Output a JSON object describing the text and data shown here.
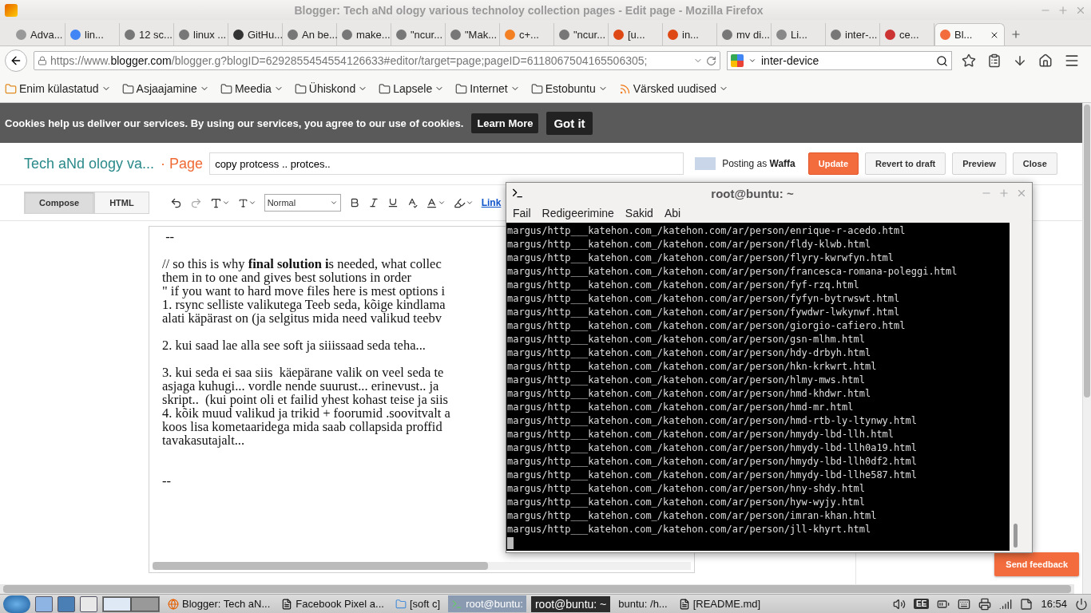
{
  "window": {
    "title": "Blogger: Tech aNd ology various technoloy collection pages - Edit page - Mozilla Firefox"
  },
  "tabs": [
    {
      "label": "Adva...",
      "selected": false
    },
    {
      "label": "lin...",
      "selected": false
    },
    {
      "label": "12 sc...",
      "selected": false
    },
    {
      "label": "linux ...",
      "selected": false
    },
    {
      "label": "GitHu...",
      "selected": false
    },
    {
      "label": "An be...",
      "selected": false
    },
    {
      "label": "make...",
      "selected": false
    },
    {
      "label": "\"ncur...",
      "selected": false
    },
    {
      "label": "\"Mak...",
      "selected": false
    },
    {
      "label": "c+...",
      "selected": false
    },
    {
      "label": "\"ncur...",
      "selected": false
    },
    {
      "label": "[u...",
      "selected": false
    },
    {
      "label": "in...",
      "selected": false
    },
    {
      "label": "mv di...",
      "selected": false
    },
    {
      "label": "Li...",
      "selected": false
    },
    {
      "label": "inter-...",
      "selected": false
    },
    {
      "label": "ce...",
      "selected": false
    },
    {
      "label": "Bl...",
      "selected": true
    }
  ],
  "address_bar": {
    "url": "https://www.**blogger.com**/blogger.g?blogID=6292855454554126633#editor/target=page;pageID=6118067504165506305;"
  },
  "search": {
    "value": "inter-device"
  },
  "bookmarks": [
    {
      "label": "Enim külastatud",
      "kind": "smart"
    },
    {
      "label": "Asjaajamine",
      "kind": "folder"
    },
    {
      "label": "Meedia",
      "kind": "folder"
    },
    {
      "label": "Ühiskond",
      "kind": "folder"
    },
    {
      "label": "Lapsele",
      "kind": "folder"
    },
    {
      "label": "Internet",
      "kind": "folder"
    },
    {
      "label": "Estobuntu",
      "kind": "folder"
    },
    {
      "label": "Värsked uudised",
      "kind": "feed"
    }
  ],
  "cookie_bar": {
    "message": "Cookies help us deliver our services. By using our services, you agree to our use of cookies.",
    "learn_more": "Learn More",
    "accept": "Got it"
  },
  "blogger": {
    "blog_title": "Tech aNd ology va...",
    "section": "· Page",
    "page_title": "copy protcess .. protces..",
    "posting_as": "Posting as **Waffa**",
    "actions": [
      {
        "label": "Update",
        "kind": "primary"
      },
      {
        "label": "Revert to draft",
        "kind": "default"
      },
      {
        "label": "Preview",
        "kind": "default"
      },
      {
        "label": "Close",
        "kind": "default"
      }
    ],
    "mode_tabs": [
      {
        "label": "Compose",
        "selected": true
      },
      {
        "label": "HTML",
        "selected": false
      }
    ],
    "paragraph_style": "Normal",
    "link": "Link",
    "body": [
      {
        "lines": [
          " --"
        ]
      },
      {
        "lines": [
          "// so this is why **final solution i**s needed, what collec",
          "them in to one and gives best solutions in order",
          "\" if you want to hard move files here is mest options i",
          "1. rsync selliste valikutega Teeb seda, kõige kindlama",
          "alati käpärast on (ja selgitus mida need valikud teebv"
        ]
      },
      {
        "lines": [
          "2. kui saad lae alla see soft ja siiissaad seda teha..."
        ]
      },
      {
        "lines": [
          "3. kui seda ei saa siis  käepärane valik on veel seda te",
          "asjaga kuhugi... vordle nende suurust... erinevust.. ja",
          "skript..  (kui point oli et failid yhest kohast teise ja siis",
          "4. kõik muud valikud ja trikid + foorumid .soovitvalt a",
          "koos lisa kometaaridega mida saab collapsida proffid",
          "tavakasutajalt..."
        ]
      },
      {
        "lines": [
          "--"
        ]
      }
    ],
    "feedback": "Send feedback"
  },
  "terminal": {
    "title": "root@buntu: ~",
    "menu": [
      "Fail",
      "Redigeerimine",
      "Sakid",
      "Abi"
    ],
    "lines": [
      "margus/http___katehon.com_/katehon.com/ar/person/enrique-r-acedo.html",
      "margus/http___katehon.com_/katehon.com/ar/person/fldy-klwb.html",
      "margus/http___katehon.com_/katehon.com/ar/person/flyry-kwrwfyn.html",
      "margus/http___katehon.com_/katehon.com/ar/person/francesca-romana-poleggi.html",
      "margus/http___katehon.com_/katehon.com/ar/person/fyf-rzq.html",
      "margus/http___katehon.com_/katehon.com/ar/person/fyfyn-bytrwswt.html",
      "margus/http___katehon.com_/katehon.com/ar/person/fywdwr-lwkynwf.html",
      "margus/http___katehon.com_/katehon.com/ar/person/giorgio-cafiero.html",
      "margus/http___katehon.com_/katehon.com/ar/person/gsn-mlhm.html",
      "margus/http___katehon.com_/katehon.com/ar/person/hdy-drbyh.html",
      "margus/http___katehon.com_/katehon.com/ar/person/hkn-krkwrt.html",
      "margus/http___katehon.com_/katehon.com/ar/person/hlmy-mws.html",
      "margus/http___katehon.com_/katehon.com/ar/person/hmd-khdwr.html",
      "margus/http___katehon.com_/katehon.com/ar/person/hmd-mr.html",
      "margus/http___katehon.com_/katehon.com/ar/person/hmd-rtb-ly-ltynwy.html",
      "margus/http___katehon.com_/katehon.com/ar/person/hmydy-lbd-llh.html",
      "margus/http___katehon.com_/katehon.com/ar/person/hmydy-lbd-llh0a19.html",
      "margus/http___katehon.com_/katehon.com/ar/person/hmydy-lbd-llh0df2.html",
      "margus/http___katehon.com_/katehon.com/ar/person/hmydy-lbd-llhe587.html",
      "margus/http___katehon.com_/katehon.com/ar/person/hny-shdy.html",
      "margus/http___katehon.com_/katehon.com/ar/person/hyw-wyjy.html",
      "margus/http___katehon.com_/katehon.com/ar/person/imran-khan.html",
      "margus/http___katehon.com_/katehon.com/ar/person/jll-khyrt.html"
    ]
  },
  "taskbar": {
    "windows": [
      {
        "label": "Blogger: Tech aN...",
        "kind": "browser",
        "selected": false
      },
      {
        "label": "Facebook Pixel  a...",
        "kind": "document",
        "selected": false
      },
      {
        "label": "[soft c]",
        "kind": "folder",
        "selected": false
      },
      {
        "label": "root@buntu:",
        "kind": "terminal",
        "selected": true
      }
    ],
    "tooltip": "root@buntu: ~",
    "windows_after": [
      {
        "label": "buntu: /h...",
        "kind": "plain",
        "selected": false
      },
      {
        "label": "[README.md]",
        "kind": "document",
        "selected": false
      }
    ],
    "keyboard_layout": "EE",
    "clock": "16:54"
  }
}
